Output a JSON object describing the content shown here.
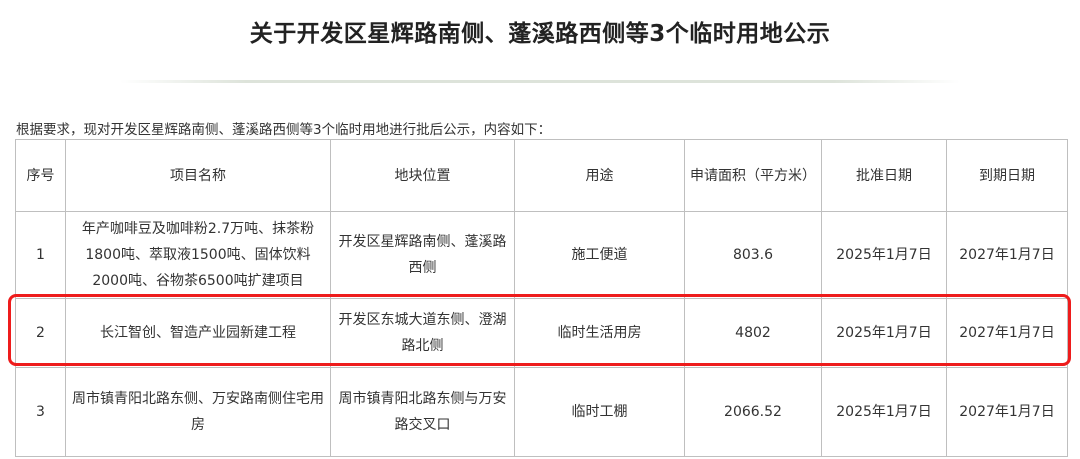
{
  "title": "关于开发区星辉路南侧、蓬溪路西侧等3个临时用地公示",
  "intro": "根据要求，现对开发区星辉路南侧、蓬溪路西侧等3个临时用地进行批后公示，内容如下：",
  "table": {
    "headers": [
      "序号",
      "项目名称",
      "地块位置",
      "用途",
      "申请面积（平方米）",
      "批准日期",
      "到期日期"
    ],
    "rows": [
      {
        "no": "1",
        "project": "年产咖啡豆及咖啡粉2.7万吨、抹茶粉1800吨、萃取液1500吨、固体饮料2000吨、谷物茶6500吨扩建项目",
        "location": "开发区星辉路南侧、蓬溪路西侧",
        "usage": "施工便道",
        "area": "803.6",
        "approval_date": "2025年1月7日",
        "expiry_date": "2027年1月7日"
      },
      {
        "no": "2",
        "project": "长江智创、智造产业园新建工程",
        "location": "开发区东城大道东侧、澄湖路北侧",
        "usage": "临时生活用房",
        "area": "4802",
        "approval_date": "2025年1月7日",
        "expiry_date": "2027年1月7日"
      },
      {
        "no": "3",
        "project": "周市镇青阳北路东侧、万安路南侧住宅用房",
        "location": "周市镇青阳北路东侧与万安路交叉口",
        "usage": "临时工棚",
        "area": "2066.52",
        "approval_date": "2025年1月7日",
        "expiry_date": "2027年1月7日"
      }
    ]
  },
  "highlight_color": "#ee1c1c"
}
